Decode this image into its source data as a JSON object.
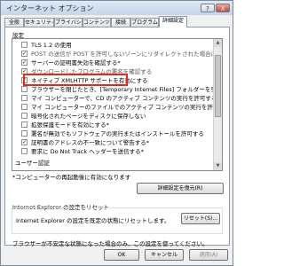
{
  "window": {
    "title": "インターネット オプション",
    "help_label": "?",
    "close_label": "X"
  },
  "tabs": [
    "全般",
    "セキュリティ",
    "プライバシー",
    "コンテンツ",
    "接続",
    "プログラム",
    "詳細設定"
  ],
  "panel": {
    "section_label": "設定",
    "settings": [
      {
        "label": "TLS 1.2 の使用",
        "checked": false
      },
      {
        "label": "POST の送信が POST を許可しないゾーンにリダイレクトされた場合に警告する",
        "checked": true
      },
      {
        "label": "サーバーの証明書失効を確認する*",
        "checked": true
      },
      {
        "label": "ダウンロードしたプログラムの署名を確認する",
        "checked": true
      },
      {
        "label": "ネイティブ XMLHTTP サポートを有効にする",
        "checked": true
      },
      {
        "label": "ブラウザーを閉じたとき、[Temporary Internet Files] フォルダーを空",
        "checked": false
      },
      {
        "label": "マイ コンピューターで、CD のアクティブ コンテンツの実行を許可する*",
        "checked": false
      },
      {
        "label": "マイ コンピューターのファイルでのアクティブ コンテンツの実行を許可する*",
        "checked": false
      },
      {
        "label": "暗号化されたページをディスクに保存しない",
        "checked": false
      },
      {
        "label": "拡張保護モードを有効にする*",
        "checked": false
      },
      {
        "label": "署名が無効でもソフトウェアの実行またはインストールを許可する",
        "checked": false
      },
      {
        "label": "証明書のアドレスの不一致について警告する*",
        "checked": true
      },
      {
        "label": "要求に Do Not Track ヘッダーを送信する*",
        "checked": false
      },
      {
        "label": "ユーザー認証",
        "checked": false
      }
    ],
    "note": "*コンピューターの再起動後に有効になります",
    "restore_button": "詳細設定を復元(R)",
    "reset_group_title": "Internet Explorer の設定をリセット",
    "reset_text": "Internet Explorer の設定を既定の状態にリセットします。",
    "reset_button": "リセット(S)...",
    "warning": "ブラウザーが不安定な状態になった場合のみ、この設定を使ってください。"
  },
  "footer": {
    "ok": "OK",
    "cancel": "キャンセル",
    "apply": "適用(A)"
  }
}
